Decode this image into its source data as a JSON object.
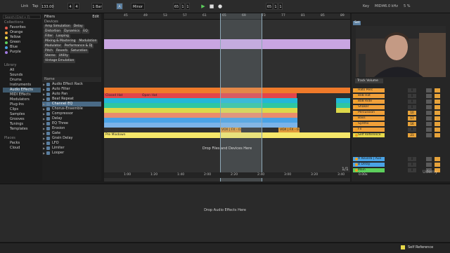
{
  "transport": {
    "link": "Link",
    "tap": "Tap",
    "tempo": "133.00",
    "time_sig_num": "4",
    "time_sig_den": "4",
    "quantize": "1 Bar",
    "key": "A",
    "scale": "Minor",
    "pos1": "65",
    "pos2": "1",
    "pos3": "1",
    "pos4": "65",
    "pos5": "1",
    "pos6": "1",
    "key_btn": "Key",
    "midi": "MIDI",
    "cpu": "46.0 kHz",
    "cpu_pct": "5 %",
    "search_placeholder": "Search (Cmd + F)"
  },
  "collections": {
    "header": "Collections",
    "items": [
      {
        "label": "Favorites",
        "color": "#e25b4f"
      },
      {
        "label": "Orange",
        "color": "#f0a03a"
      },
      {
        "label": "Yellow",
        "color": "#e6d84a"
      },
      {
        "label": "Green",
        "color": "#5ccf5c"
      },
      {
        "label": "Blue",
        "color": "#4aa3e6"
      },
      {
        "label": "Purple",
        "color": "#a17be0"
      }
    ],
    "library_header": "Library",
    "library": [
      "All",
      "Sounds",
      "Drums",
      "Instruments",
      "Audio Effects",
      "MIDI Effects",
      "Modulators",
      "Plug-Ins",
      "Clips",
      "Samples",
      "Grooves",
      "Tunings",
      "Templates"
    ],
    "selected": "Audio Effects",
    "places_header": "Places",
    "places": [
      "Packs",
      "Cloud"
    ]
  },
  "filters": {
    "title": "Filters",
    "edit": "Edit",
    "devices_label": "Devices",
    "tags": [
      "Amp Simulation",
      "Delay",
      "Distortion",
      "Dynamics",
      "EQ",
      "Filter",
      "Looping",
      "Mixing & Mastering",
      "Modulation",
      "Modulator",
      "Performance & DJ",
      "Pitch",
      "Reverb",
      "Saturation",
      "Stereo",
      "Utility",
      "Vintage Emulation"
    ]
  },
  "namelist": {
    "header": "Name",
    "items": [
      "Audio Effect Rack",
      "Auto Filter",
      "Auto Pan",
      "Beat Repeat",
      "Channel EQ",
      "Chorus-Ensemble",
      "Compressor",
      "Delay",
      "EQ Three",
      "Erosion",
      "Gate",
      "Grain Delay",
      "LFO",
      "Limiter",
      "Looper"
    ],
    "selected": "Channel EQ"
  },
  "ruler": {
    "marks": [
      "45",
      "49",
      "53",
      "57",
      "61",
      "65",
      "69",
      "73",
      "77",
      "81",
      "85",
      "89",
      "93"
    ]
  },
  "time_ruler": {
    "marks": [
      "1:00",
      "1:20",
      "1:40",
      "2:00",
      "2:20",
      "2:40",
      "3:00",
      "3:20",
      "3:40"
    ]
  },
  "clips": {
    "closed_hat": "Closed Hat",
    "open_hat": "Open Hat",
    "vox_fx_1": "VOX | FX - 02",
    "vox_fx_2": "VOX | FX - 03",
    "pre_mixdown": "Pre Mixdown"
  },
  "drop_hint": "Drop Files and Devices Here",
  "mixer": {
    "set_label": "Set",
    "track_volume": "Track Volume",
    "tracks": [
      {
        "name": "Hats Perc",
        "color": "#f0a03a",
        "vol": "0"
      },
      {
        "name": "808 Hat",
        "color": "#f0a03a",
        "vol": "0"
      },
      {
        "name": "808 Ride",
        "color": "#f0a03a",
        "vol": "0"
      },
      {
        "name": "Shaker",
        "color": "#f0a03a",
        "vol": "0"
      },
      {
        "name": "Percussion",
        "color": "#f0a03a",
        "vol": "10"
      },
      {
        "name": "Bass",
        "color": "#f0a03a",
        "vol": "17"
      },
      {
        "name": "Synths",
        "color": "#f0a03a",
        "vol": "16"
      },
      {
        "name": "Fx",
        "color": "#f0a03a",
        "vol": "0"
      },
      {
        "name": "Self Reference",
        "color": "#e6d84a",
        "vol": "21"
      },
      {
        "name": "A Reverb | Aux",
        "color": "#4aa3e6",
        "vol": "0"
      },
      {
        "name": "B Delay",
        "color": "#4aa3e6",
        "vol": "0"
      },
      {
        "name": "Main",
        "color": "#5ccf5c",
        "vol": "0"
      }
    ],
    "send_value": "1/2",
    "pages": "1/1",
    "zoom": "0.00x"
  },
  "device_hint": "Drop Audio Effects Here",
  "status": {
    "track": "Self Reference"
  },
  "watermark": "Udemy"
}
